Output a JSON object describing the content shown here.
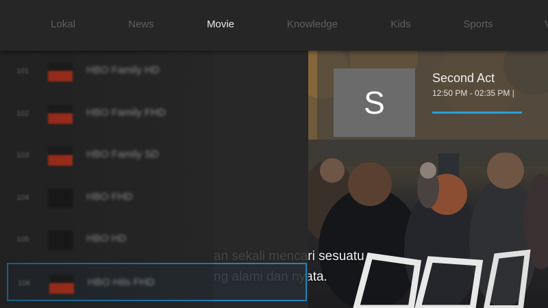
{
  "topbar": {
    "tabs": [
      {
        "label": "Lokal",
        "active": false
      },
      {
        "label": "News",
        "active": false
      },
      {
        "label": "Movie",
        "active": true
      },
      {
        "label": "Knowledge",
        "active": false
      },
      {
        "label": "Kids",
        "active": false
      },
      {
        "label": "Sports",
        "active": false
      },
      {
        "label": "V",
        "active": false
      }
    ]
  },
  "channels": [
    {
      "number": "101",
      "name": "HBO Family HD",
      "logo": "hbo-logo"
    },
    {
      "number": "102",
      "name": "HBO Family FHD",
      "logo": "hbo-logo"
    },
    {
      "number": "103",
      "name": "HBO Family SD",
      "logo": "hbo-logo"
    },
    {
      "number": "104",
      "name": "HBO FHD",
      "logo": "dark-logo"
    },
    {
      "number": "105",
      "name": "HBO HD",
      "logo": "dark-logo"
    },
    {
      "number": "106",
      "name": "HBO Hits FHD",
      "logo": "hbo-logo",
      "focused": true
    }
  ],
  "program": {
    "logo_letter": "S",
    "title": "Second Act",
    "time": "12:50 PM - 02:35 PM |",
    "progress": 1.0
  },
  "subtitle": {
    "line1": "an sekali mencari sesuatu",
    "line2": "ng alami dan nyata."
  },
  "colors": {
    "accent": "#2a9fd8",
    "focus_border": "#1e83c0",
    "logo_red": "#c8341c"
  }
}
